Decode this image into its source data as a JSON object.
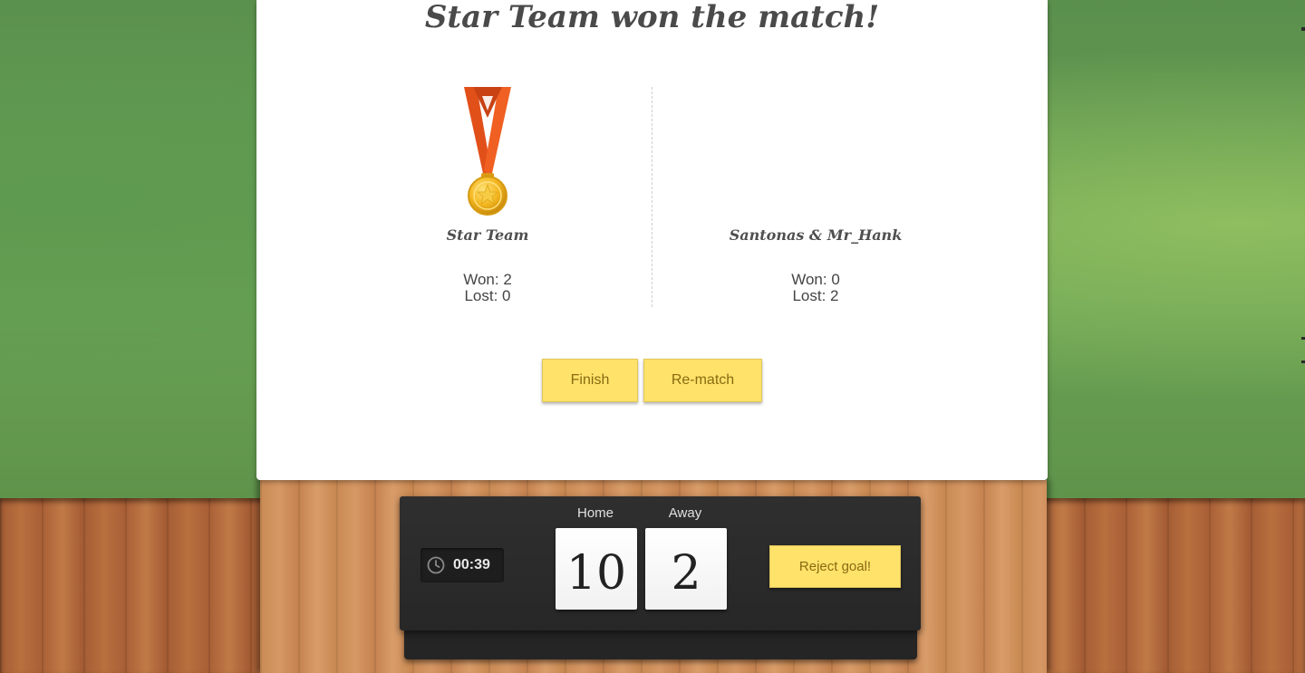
{
  "modal": {
    "title": "Star Team won the match!",
    "teams": [
      {
        "name": "Star Team",
        "won": "Won: 2",
        "lost": "Lost: 0",
        "winner": true
      },
      {
        "name": "Santonas & Mr_Hank",
        "won": "Won: 0",
        "lost": "Lost: 2",
        "winner": false
      }
    ],
    "buttons": {
      "finish": "Finish",
      "rematch": "Re-match"
    }
  },
  "scoreboard": {
    "timer": "00:39",
    "timer_icon": "clock-icon",
    "home_label": "Home",
    "away_label": "Away",
    "home_score": "10",
    "away_score": "2",
    "reject_goal": "Reject goal!"
  },
  "colors": {
    "felt": "#6a9a4e",
    "wood": "#a9643a",
    "button": "#ffe26a",
    "button_text": "#8a6a12",
    "medal_ribbon": "#e8541c",
    "medal_gold": "#f0b21c"
  }
}
